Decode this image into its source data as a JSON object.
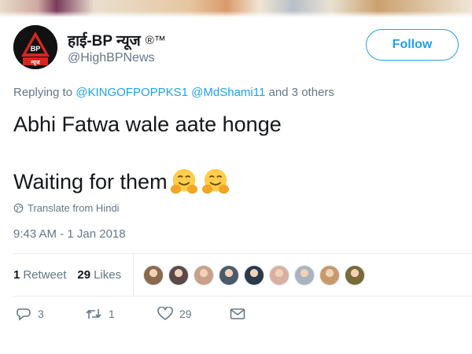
{
  "tweet": {
    "display_name": "हाई-BP न्यूज",
    "name_marks": "®™",
    "handle": "@HighBPNews",
    "avatar_text": "BP",
    "avatar_sub": "न्यूज",
    "follow_label": "Follow",
    "replying_prefix": "Replying to",
    "replying_mentions": [
      "@KINGOFPOPPKS1",
      "@MdShami11"
    ],
    "replying_suffix": "and 3 others",
    "text_line1": "Abhi Fatwa wale aate honge",
    "text_line2": "Waiting for them",
    "emoji": [
      "hugging-face-emoji",
      "hugging-face-emoji"
    ],
    "translate_label": "Translate from Hindi",
    "timestamp": "9:43 AM - 1 Jan 2018",
    "stats": {
      "retweets_count": "1",
      "retweets_label": "Retweet",
      "likes_count": "29",
      "likes_label": "Likes"
    },
    "likers": [
      "#8a6a4a",
      "#5a4a4a",
      "#c9a08a",
      "#4a5a6a",
      "#2a3a4a",
      "#d8b0a0",
      "#aab4be",
      "#c89a6a",
      "#7a6a3a"
    ],
    "actions": {
      "reply_count": "3",
      "retweet_count": "1",
      "like_count": "29"
    }
  },
  "colors": {
    "accent": "#1da1f2",
    "muted": "#657786",
    "text": "#14171a",
    "avatar_red": "#d7261e"
  }
}
